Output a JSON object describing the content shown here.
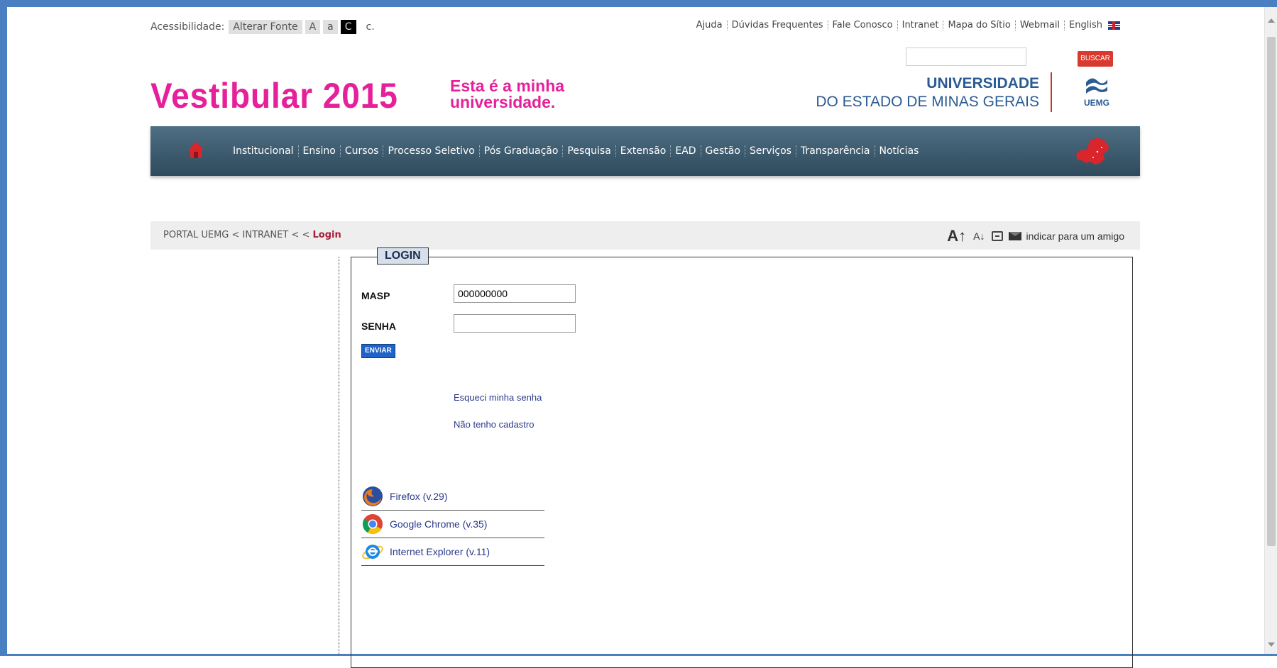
{
  "accessibility": {
    "label": "Acessibilidade:",
    "change_font": "Alterar Fonte",
    "font_a_upper": "A",
    "font_a_lower": "a",
    "contrast": "C",
    "c_label": "c."
  },
  "top_links": [
    "Ajuda",
    "Dúvidas Frequentes",
    "Fale Conosco",
    "Intranet",
    "Mapa do Sítio",
    "Webmail",
    "English"
  ],
  "search": {
    "button": "BUSCAR",
    "value": ""
  },
  "header": {
    "title": "Vestibular 2015",
    "slogan_line1": "Esta é a minha",
    "slogan_line2": "universidade.",
    "univ_line1": "UNIVERSIDADE",
    "univ_line2": "DO ESTADO DE MINAS GERAIS",
    "logo_text": "UEMG"
  },
  "nav": [
    "Institucional",
    "Ensino",
    "Cursos",
    "Processo Seletivo",
    "Pós Graduação",
    "Pesquisa",
    "Extensão",
    "EAD",
    "Gestão",
    "Serviços",
    "Transparência",
    "Notícias"
  ],
  "breadcrumb": {
    "prefix": "PORTAL UEMG < INTRANET < < ",
    "current": "Login"
  },
  "tools": {
    "font_inc": "A↑",
    "font_dec": "A↓",
    "friend": "indicar para um amigo"
  },
  "login": {
    "legend": "LOGIN",
    "masp_label": "MASP",
    "masp_value": "000000000",
    "senha_label": "SENHA",
    "senha_value": "",
    "submit": "ENVIAR",
    "forgot": "Esqueci minha senha",
    "no_account": "Não tenho cadastro"
  },
  "browsers": [
    {
      "name": "Firefox (v.29)",
      "icon": "firefox-icon"
    },
    {
      "name": "Google Chrome (v.35)",
      "icon": "chrome-icon"
    },
    {
      "name": "Internet Explorer (v.11)",
      "icon": "ie-icon"
    }
  ],
  "colors": {
    "brand_pink": "#e5209a",
    "univ_blue": "#2a5b93",
    "nav_bg": "#3b5a6e",
    "search_button": "#d93a30",
    "breadcrumb_current": "#a4203a"
  }
}
